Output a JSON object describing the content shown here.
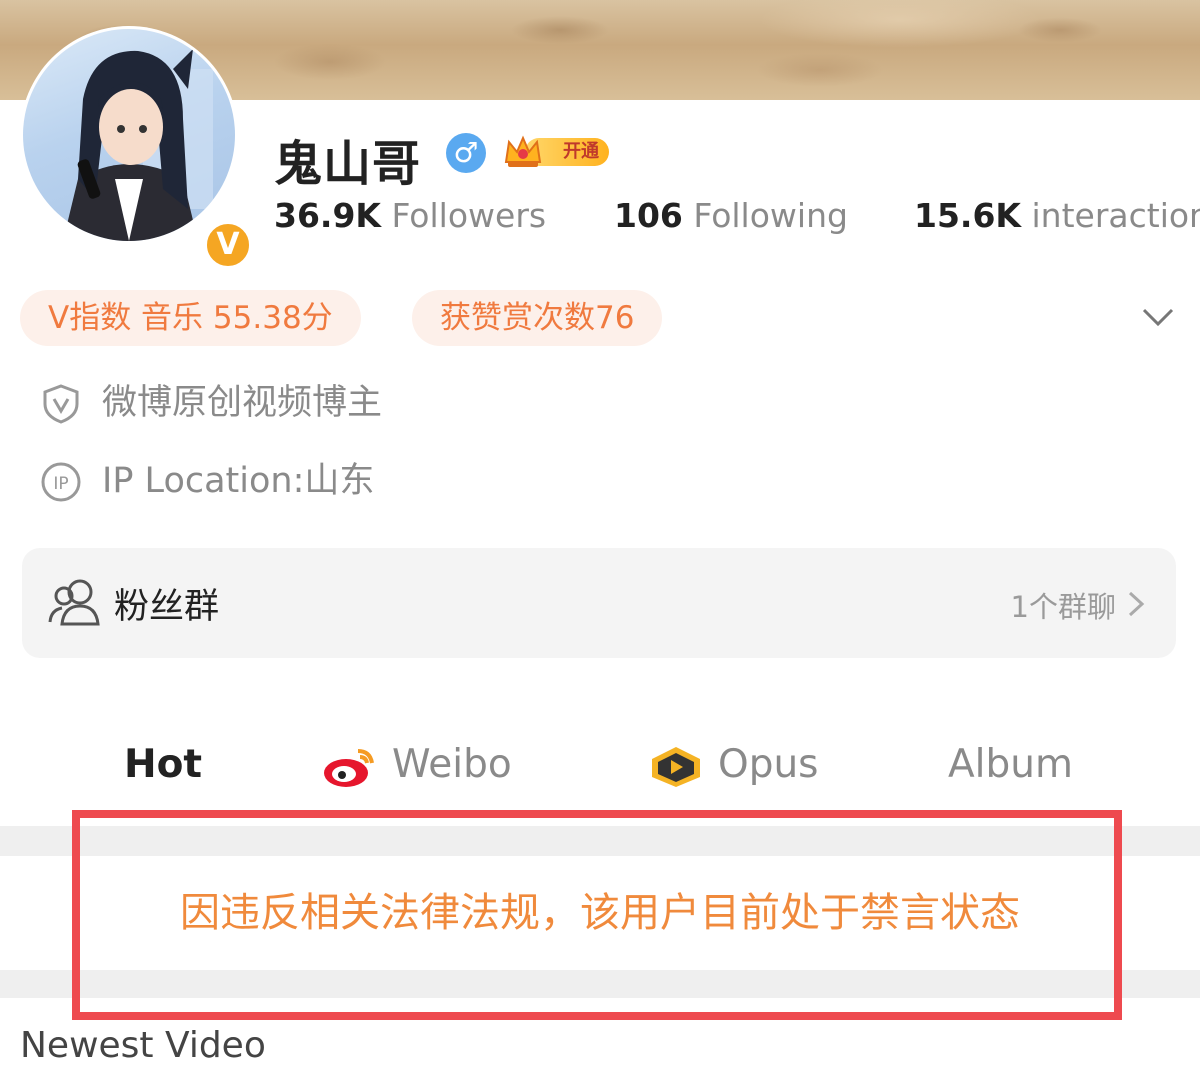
{
  "profile": {
    "name": "鬼山哥",
    "gender_symbol": "♂",
    "verified_symbol": "V",
    "vip_label": "开通"
  },
  "stats": [
    {
      "value": "36.9K",
      "label": "Followers"
    },
    {
      "value": "106",
      "label": "Following"
    },
    {
      "value": "15.6K",
      "label": "interaction"
    }
  ],
  "tags": [
    "V指数 音乐 55.38分",
    "获赞赏次数76"
  ],
  "info": {
    "creator": "微博原创视频博主",
    "ip_location": "IP Location:山东"
  },
  "fan_group": {
    "label": "粉丝群",
    "count_text": "1个群聊"
  },
  "tabs": [
    {
      "label": "Hot",
      "active": true
    },
    {
      "label": "Weibo",
      "active": false
    },
    {
      "label": "Opus",
      "active": false
    },
    {
      "label": "Album",
      "active": false
    }
  ],
  "notice": "因违反相关法律法规，该用户目前处于禁言状态",
  "section": {
    "newest_video": "Newest Video"
  },
  "colors": {
    "accent_orange": "#f07a3f",
    "notice_orange": "#f08a3c",
    "highlight_red": "#ee4a4f",
    "verified_gold": "#f5a623",
    "gender_blue": "#5aa9f0"
  },
  "icons": {
    "chevron_down": "chevron-down-icon",
    "creator": "shield-v-icon",
    "ip": "ip-icon",
    "fan_group": "group-icon",
    "chevron_right": "chevron-right-icon",
    "weibo": "weibo-logo-icon",
    "opus": "opus-play-icon"
  }
}
